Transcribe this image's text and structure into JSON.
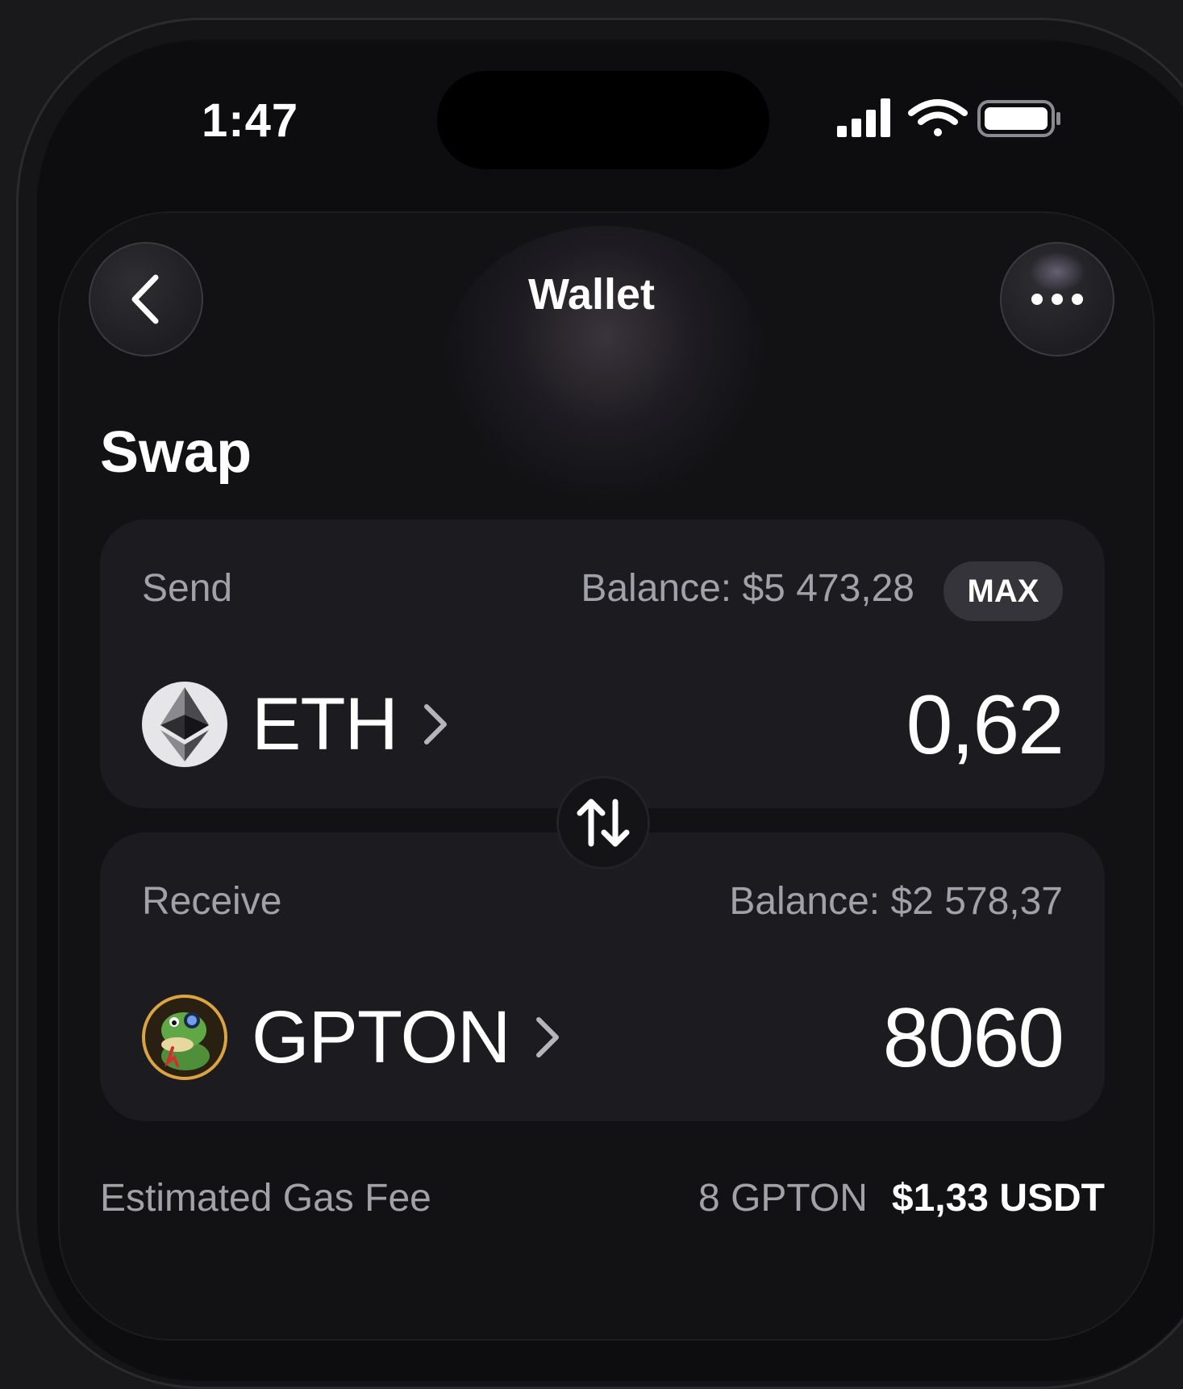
{
  "status_bar": {
    "time": "1:47",
    "icons": [
      "cellular-signal-icon",
      "wifi-icon",
      "battery-icon"
    ]
  },
  "nav": {
    "title": "Wallet",
    "back_icon": "chevron-left-icon",
    "more_icon": "ellipsis-icon"
  },
  "page": {
    "title": "Swap"
  },
  "send": {
    "label": "Send",
    "balance": "Balance: $5 473,28",
    "max_label": "MAX",
    "token_symbol": "ETH",
    "token_icon": "ethereum-logo-icon",
    "amount": "0,62"
  },
  "swap_toggle_icon": "swap-arrows-icon",
  "receive": {
    "label": "Receive",
    "balance": "Balance: $2 578,37",
    "token_symbol": "GPTON",
    "token_icon": "gpton-snake-logo-icon",
    "amount": "8060"
  },
  "fee": {
    "label": "Estimated Gas Fee",
    "token_amount": "8 GPTON",
    "usd_amount": "$1,33 USDT"
  },
  "colors": {
    "background": "#0d0d0f",
    "card": "#1c1c20",
    "muted_text": "#a1a1a8",
    "text": "#ffffff"
  }
}
